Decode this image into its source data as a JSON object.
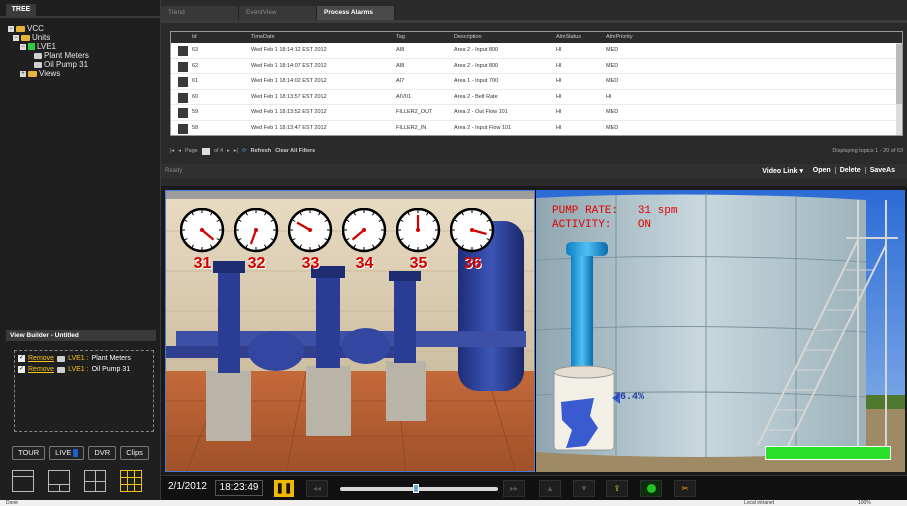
{
  "left": {
    "tree_tab": "TREE",
    "tree": {
      "vcc": "VCC",
      "units": "Units",
      "lve1": "LVE1",
      "plant_meters": "Plant Meters",
      "oil_pump": "Oil Pump 31",
      "views": "Views"
    },
    "view_builder": {
      "title": "View Builder - Untitled",
      "items": [
        {
          "remove": "Remove",
          "unit": "LVE1 :",
          "name": "Plant Meters"
        },
        {
          "remove": "Remove",
          "unit": "LVE1 :",
          "name": "Oil Pump 31"
        }
      ]
    },
    "modes": {
      "tour": "TOUR",
      "live": "LIVE",
      "dvr": "DVR",
      "clips": "Clips"
    },
    "layout_icon_names": [
      "single-layout-icon",
      "two-by-one-layout-icon",
      "two-by-two-layout-icon",
      "three-by-three-layout-icon"
    ]
  },
  "alarms": {
    "tabs": [
      "Trend",
      "EventView",
      "Process Alarms"
    ],
    "active_tab": "Process Alarms",
    "columns": [
      "",
      "Id",
      "TimeDate",
      "Tag",
      "Description",
      "AlmStatus",
      "AlmPriority"
    ],
    "rows": [
      {
        "id": "63",
        "time": "Wed Feb 1 18:14:12 EST 2012",
        "tag": "AI8",
        "desc": "Area 2 - Input 800",
        "status": "HI",
        "priority": "MED"
      },
      {
        "id": "62",
        "time": "Wed Feb 1 18:14:07 EST 2012",
        "tag": "AI8",
        "desc": "Area 2 - Input 800",
        "status": "HI",
        "priority": "MED"
      },
      {
        "id": "61",
        "time": "Wed Feb 1 18:14:02 EST 2012",
        "tag": "AI7",
        "desc": "Area 1 - Input 700",
        "status": "HI",
        "priority": "MED"
      },
      {
        "id": "60",
        "time": "Wed Feb 1 18:13:57 EST 2012",
        "tag": "AIV01",
        "desc": "Area 2 - Belt Rate",
        "status": "HI",
        "priority": "HI"
      },
      {
        "id": "59",
        "time": "Wed Feb 1 18:13:52 EST 2012",
        "tag": "FILLER2_OUT",
        "desc": "Area 2 - Out Flow 101",
        "status": "HI",
        "priority": "MED"
      },
      {
        "id": "58",
        "time": "Wed Feb 1 18:13:47 EST 2012",
        "tag": "FILLER2_IN",
        "desc": "Area 2 - Input Flow 101",
        "status": "HI",
        "priority": "MED"
      }
    ],
    "pager": {
      "page_label": "Page",
      "page_value": "1",
      "of_label": "of 4",
      "refresh": "Refresh",
      "clear": "Clear All Filters",
      "display": "Displaying topics 1 - 20 of 63"
    },
    "status": {
      "ready": "Ready",
      "video_link": "Video Link ▾",
      "open": "Open",
      "delete": "Delete",
      "saveas": "SaveAs"
    }
  },
  "video": {
    "gauges": [
      {
        "label": "31",
        "hand_deg": 130
      },
      {
        "label": "32",
        "hand_deg": 200
      },
      {
        "label": "33",
        "hand_deg": 300
      },
      {
        "label": "34",
        "hand_deg": 230
      },
      {
        "label": "35",
        "hand_deg": 0
      },
      {
        "label": "36",
        "hand_deg": 105
      }
    ],
    "overlay_line1": "PUMP RATE:   31 spm",
    "overlay_line2": "ACTIVITY:    ON",
    "tank_level": "76.4%",
    "colors": {
      "alarm_red": "#d20000",
      "level_blue": "#1f3ea6",
      "status_green": "#2ae02a",
      "accent_yellow": "#f1b800"
    }
  },
  "transport": {
    "date": "2/1/2012",
    "time": "18:23:49",
    "pause": "❚❚"
  },
  "window": {
    "done": "Done",
    "zone": "Local intranet",
    "zoom": "100%"
  }
}
